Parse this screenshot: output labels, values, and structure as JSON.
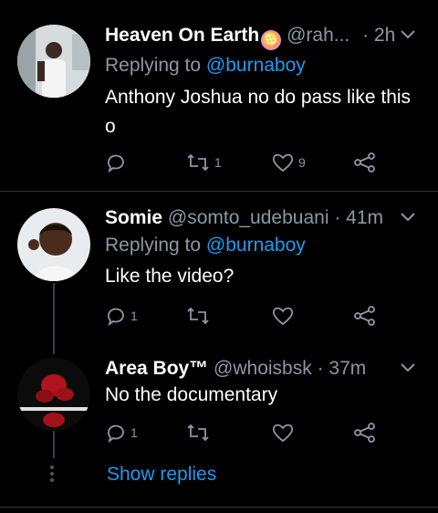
{
  "tweets": [
    {
      "name": "Heaven On Earth",
      "emoji": "♋",
      "handle": "@rah...",
      "time": "· 2h",
      "replying_prefix": "Replying to",
      "replying_handle": "@burnaboy",
      "text_line1": "Anthony Joshua no do pass like this",
      "text_line2": "o",
      "replies": "",
      "retweets": "1",
      "likes": "9"
    },
    {
      "name": "Somie",
      "handle": "@somto_udebuani",
      "time": "· 41m",
      "replying_prefix": "Replying to",
      "replying_handle": "@burnaboy",
      "text": "Like the video?",
      "replies": "1",
      "retweets": "",
      "likes": ""
    },
    {
      "name": "Area Boy™",
      "handle": "@whoisbsk",
      "time": "· 37m",
      "text": "No the documentary",
      "replies": "1",
      "retweets": "",
      "likes": ""
    }
  ],
  "show_replies": "Show replies",
  "colors": {
    "link": "#1d9bf0",
    "muted": "#8b98a5",
    "background": "#000000"
  }
}
